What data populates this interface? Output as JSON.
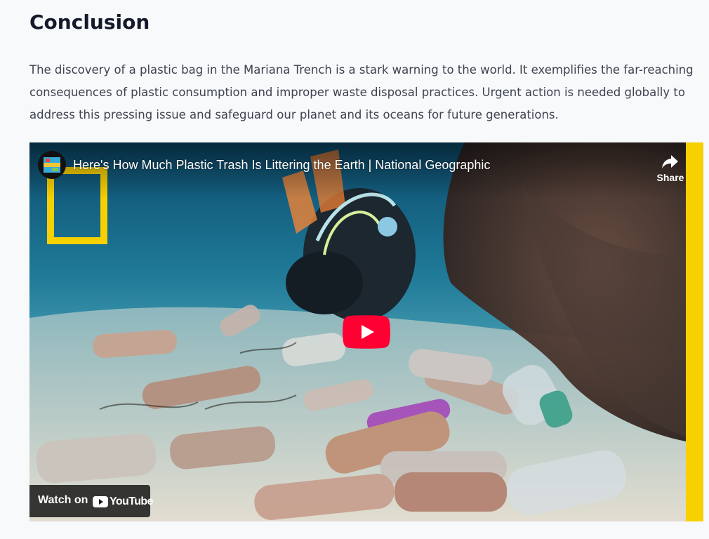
{
  "article": {
    "heading": "Conclusion",
    "paragraph_lines": [
      "The discovery of a plastic bag in the Mariana Trench is a stark warning to the world. It exemplifies the far-reaching",
      "consequences of plastic consumption and improper waste disposal practices. Urgent action is needed globally to",
      "address this pressing issue and safeguard our planet and its oceans for future generations."
    ]
  },
  "video": {
    "title": "Here's How Much Plastic Trash Is Littering the Earth | National Geographic",
    "share_label": "Share",
    "watch_on_label": "Watch on",
    "youtube_wordmark": "YouTube",
    "icons": {
      "channel": "national-geographic-channel-avatar",
      "share": "share-arrow-icon",
      "play": "youtube-play-icon",
      "youtube": "youtube-logo-icon"
    },
    "colors": {
      "play_red": "#ff0033",
      "natgeo_yellow": "#f7d000"
    }
  }
}
